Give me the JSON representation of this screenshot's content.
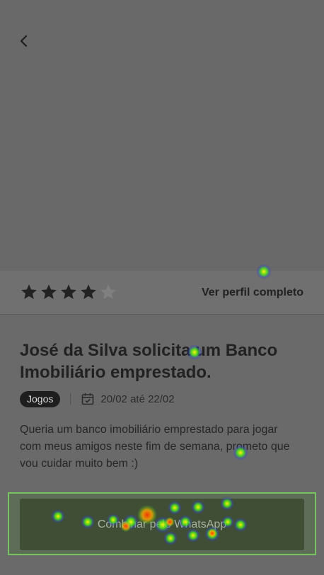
{
  "hero": {
    "back_icon": "chevron-left-icon"
  },
  "rating": {
    "value": 4,
    "max": 5,
    "star_icon": "star-icon",
    "filled_color": "#222222",
    "empty_color": "#808080",
    "profile_link_label": "Ver perfil completo"
  },
  "request": {
    "title": "José da Silva solicita um Banco Imobiliário emprestado.",
    "category": "Jogos",
    "calendar_icon": "calendar-check-icon",
    "dates": "20/02 até 22/02",
    "description": "Queria um banco imobiliário emprestado para jogar com meus amigos neste fim de semana, prometo que vou cuidar muito bem :)"
  },
  "cta": {
    "label": "Combinar pelo WhatsApp",
    "frame_color": "#78c262"
  }
}
